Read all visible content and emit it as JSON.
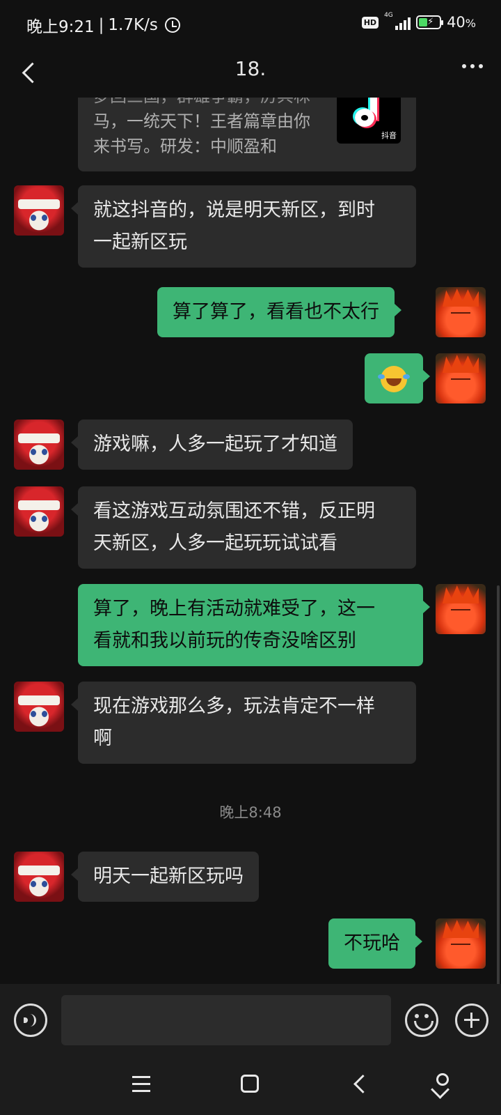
{
  "status_bar": {
    "time": "晚上9:21",
    "separator": "|",
    "net_speed": "1.7K/s",
    "hd": "HD",
    "network": "4G",
    "battery": "40",
    "battery_unit": "%"
  },
  "header": {
    "title": "18."
  },
  "share_card": {
    "desc_lines": [
      "梦回三国，群雄争霸，厉兵秣",
      "马，一统天下！王者篇章由你",
      "来书写。研发：中顺盈和"
    ],
    "app_icon_label": "抖音",
    "app_icon": "douyin-logo-icon"
  },
  "messages": [
    {
      "side": "in",
      "lines": [
        "就这抖音的，说是明天新区，到时",
        "一起新区玩"
      ]
    },
    {
      "side": "out",
      "lines": [
        "算了算了，看看也不太行"
      ]
    },
    {
      "side": "out",
      "emoji": "tears-of-joy-emoji"
    },
    {
      "side": "in",
      "lines": [
        "游戏嘛，人多一起玩了才知道"
      ]
    },
    {
      "side": "in",
      "lines": [
        "看这游戏互动氛围还不错，反正明",
        "天新区，人多一起玩玩试试看"
      ]
    },
    {
      "side": "out",
      "lines": [
        "算了，晚上有活动就难受了，这一",
        "看就和我以前玩的传奇没啥区别"
      ]
    },
    {
      "side": "in",
      "lines": [
        "现在游戏那么多，玩法肯定不一样",
        "啊"
      ]
    },
    {
      "side": "in",
      "lines": [
        "明天一起新区玩吗"
      ]
    },
    {
      "side": "out",
      "lines": [
        "不玩哈"
      ]
    }
  ],
  "time_divider": "晚上8:48",
  "input_bar": {
    "placeholder": ""
  },
  "colors": {
    "outgoing_bubble": "#3eb575",
    "incoming_bubble": "#2c2c2c",
    "background": "#111111"
  }
}
